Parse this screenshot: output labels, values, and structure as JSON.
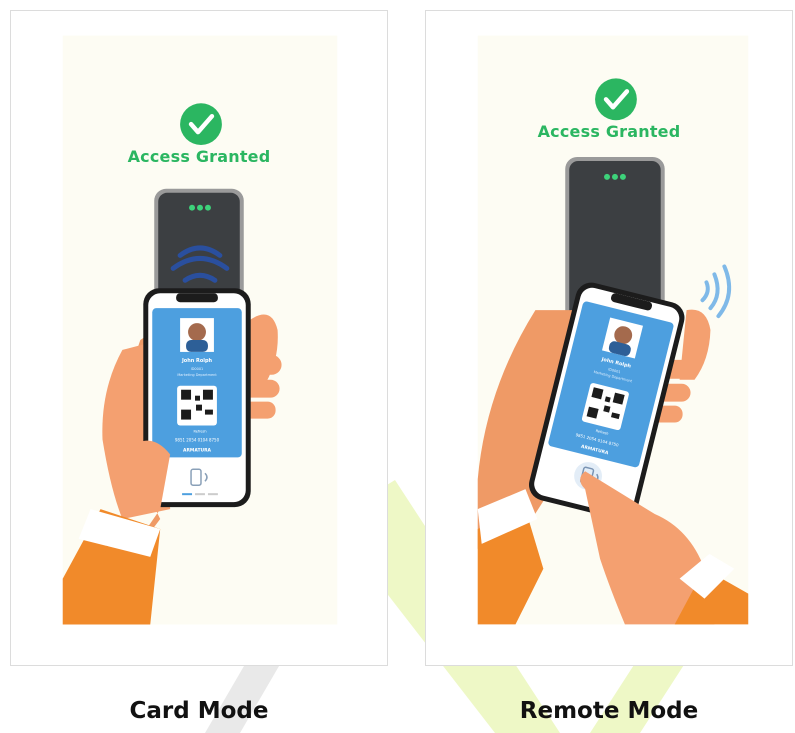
{
  "colors": {
    "access_green": "#2bb661",
    "background_cream": "#fdfcf3",
    "reader_dark": "#3c3f42",
    "nfc_blue": "#2a4f9e",
    "skin": "#f4a070",
    "sleeve_orange": "#f18a2a",
    "card_blue": "#4d9fdf",
    "watermark_green": "#d8f263"
  },
  "panels": [
    {
      "id": "card-mode",
      "status_icon": "check-circle-icon",
      "status_text": "Access Granted",
      "card": {
        "name": "John Rolph",
        "role_line1": "ID0001",
        "role_line2": "Marketing Department",
        "refresh_label": "Refresh",
        "card_number": "9851 2054 0104 8750",
        "brand": "ARMATURA"
      },
      "caption": "Card Mode"
    },
    {
      "id": "remote-mode",
      "status_icon": "check-circle-icon",
      "status_text": "Access Granted",
      "card": {
        "name": "John Rolph",
        "role_line1": "ID0001",
        "role_line2": "Marketing Department",
        "refresh_label": "Refresh",
        "card_number": "9851 2054 0104 8750",
        "brand": "ARMATURA"
      },
      "caption": "Remote Mode"
    }
  ]
}
